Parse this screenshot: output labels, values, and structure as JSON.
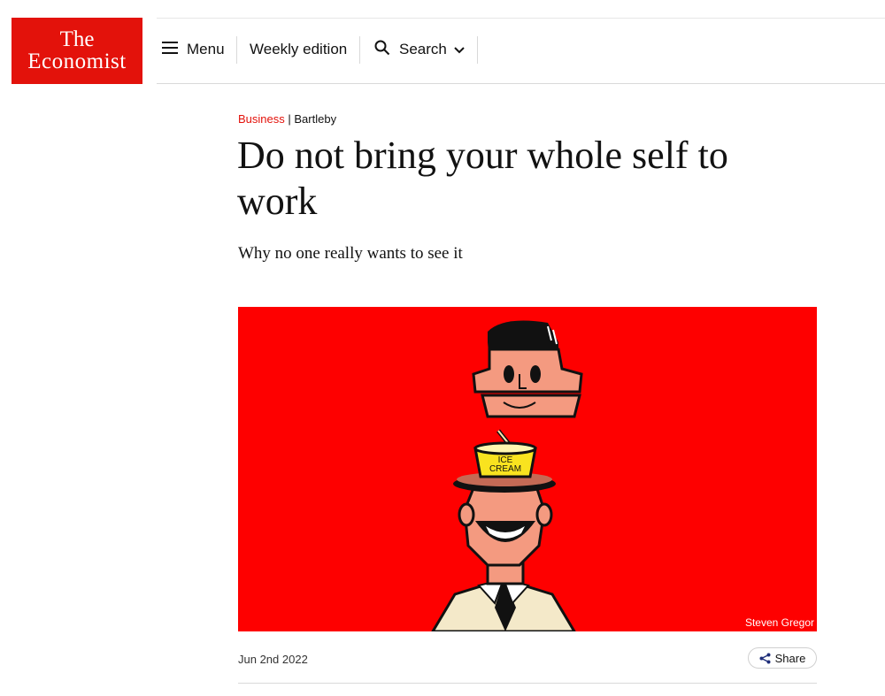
{
  "header": {
    "logo": {
      "line1": "The",
      "line2": "Economist"
    },
    "menu_label": "Menu",
    "weekly_label": "Weekly edition",
    "search_label": "Search",
    "brand_color": "#e3120b"
  },
  "article": {
    "section": "Business",
    "separator": "|",
    "column": "Bartleby",
    "headline": "Do not bring your whole self to work",
    "subheadline": "Why no one really wants to see it",
    "image": {
      "icecream_line1": "ICE",
      "icecream_line2": "CREAM",
      "credit": "Steven Gregor",
      "background_color": "#fe0000"
    },
    "date": "Jun 2nd 2022",
    "share_label": "Share"
  },
  "icons": {
    "menu": "hamburger-icon",
    "search": "magnifier-icon",
    "dropdown": "chevron-down-icon",
    "share": "share-icon"
  }
}
